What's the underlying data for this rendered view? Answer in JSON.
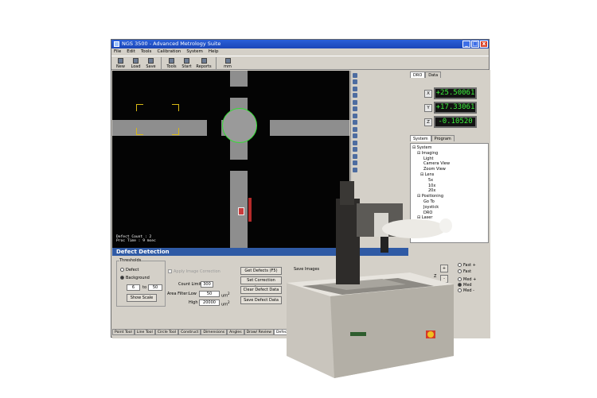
{
  "window": {
    "title": "NGS 3500 - Advanced Metrology Suite",
    "controls": [
      "_",
      "□",
      "x"
    ]
  },
  "menu": [
    "File",
    "Edit",
    "Tools",
    "Calibration",
    "System",
    "Help"
  ],
  "toolbar": [
    {
      "label": "New",
      "icon": "new-file-icon"
    },
    {
      "label": "Load",
      "icon": "folder-open-icon"
    },
    {
      "label": "Save",
      "icon": "save-icon"
    },
    {
      "label": "Tools",
      "icon": "tools-icon"
    },
    {
      "label": "Start",
      "icon": "play-icon"
    },
    {
      "label": "Reports",
      "icon": "report-icon"
    },
    {
      "label": "mm",
      "icon": "ruler-icon"
    }
  ],
  "viewer": {
    "overlay_line1": "Defect Count : 2",
    "overlay_line2": "Proc Time : 9 msec"
  },
  "dro": {
    "tabs": [
      "DRO",
      "Data"
    ],
    "axes": [
      {
        "axis": "X",
        "value": "+25.50061"
      },
      {
        "axis": "Y",
        "value": "+17.33061"
      },
      {
        "axis": "Z",
        "value": "-0.10520"
      }
    ]
  },
  "system_tabs": [
    "System",
    "Program"
  ],
  "tree": [
    {
      "label": "System",
      "depth": 0,
      "prefix": "⊟"
    },
    {
      "label": "Imaging",
      "depth": 1,
      "prefix": "⊟"
    },
    {
      "label": "Light",
      "depth": 2,
      "prefix": ""
    },
    {
      "label": "Camera View",
      "depth": 2,
      "prefix": ""
    },
    {
      "label": "Zoom View",
      "depth": 2,
      "prefix": ""
    },
    {
      "label": "Lens",
      "depth": 2,
      "prefix": "⊟"
    },
    {
      "label": "5x",
      "depth": 3,
      "prefix": ""
    },
    {
      "label": "10x",
      "depth": 3,
      "prefix": ""
    },
    {
      "label": "20x",
      "depth": 3,
      "prefix": ""
    },
    {
      "label": "Positioning",
      "depth": 1,
      "prefix": "⊟"
    },
    {
      "label": "Go To",
      "depth": 2,
      "prefix": ""
    },
    {
      "label": "Joystick",
      "depth": 2,
      "prefix": ""
    },
    {
      "label": "DRO",
      "depth": 2,
      "prefix": ""
    },
    {
      "label": "Laser",
      "depth": 1,
      "prefix": "⊟"
    }
  ],
  "defect": {
    "title": "Defect Detection",
    "thresholds_label": "Thresholds",
    "radio_defect": "Defect",
    "radio_background": "Background",
    "thr_low": "6",
    "thr_to": "to",
    "thr_high": "50",
    "show_scale": "Show Scale",
    "apply_image_correction": "Apply Image Correction",
    "count_limit_label": "Count Limit",
    "count_limit": "300",
    "area_filter_label": "Area Filter:",
    "low_label": "Low",
    "low_value": "50",
    "high_label": "High",
    "high_value": "20000",
    "unit": "um",
    "unit_sup": "2",
    "buttons": [
      "Get Defects (F5)",
      "Set Correction Image",
      "Clear Defect Data",
      "Save Defect Data"
    ],
    "save_images": "Save Images"
  },
  "bottom_tabs": [
    "Point Tool",
    "Line Tool",
    "Circle Tool",
    "Construct",
    "Dimensions",
    "Angles",
    "Draw/ Review",
    "Defect D"
  ],
  "joystick": {
    "tabs": [
      "Joystick",
      "FocusMap"
    ],
    "label_x": "X",
    "x_value": "0",
    "plus": "+",
    "minus": "-",
    "label_z": "Z",
    "speeds": [
      "Fast +",
      "Fast",
      "Med +",
      "Med",
      "Med -"
    ]
  },
  "colors": {
    "title_bar": "#1b47b8",
    "section_header": "#2f5aa5",
    "dro_text": "#3cf03c",
    "highlight": "#32e032"
  }
}
